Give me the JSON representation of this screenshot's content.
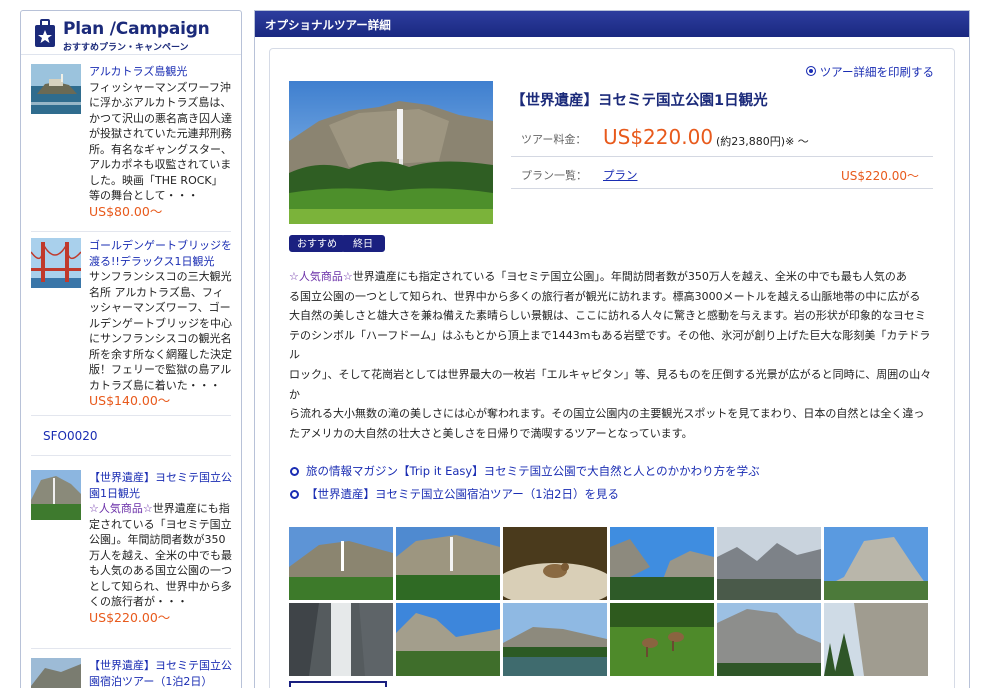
{
  "sidebar": {
    "title": "Plan /Campaign",
    "subtitle": "おすすめプラン・キャンペーン",
    "items": [
      {
        "title": "アルカトラズ島観光",
        "text": "フィッシャーマンズワーフ沖に浮かぶアルカトラズ島は、かつて沢山の悪名高き囚人達が投獄されていた元連邦刑務所。有名なギャングスター、アルカポネも収監されていました。映画「THE ROCK」等の舞台として・・・",
        "price": "US$80.00〜"
      },
      {
        "title": "ゴールデンゲートブリッジを渡る!!デラックス1日観光",
        "text": "サンフランシスコの三大観光名所 アルカトラズ島、フィッシャーマンズワーフ、ゴールデンゲートブリッジを中心にサンフランシスコの観光名所を余す所なく網羅した決定版！フェリーで監獄の島アルカトラズ島に着いた・・・",
        "price": "US$140.00〜"
      },
      {
        "title": "【世界遺産】ヨセミテ国立公園1日観光",
        "text_hl": "☆人気商品☆",
        "text": "世界遺産にも指定されている「ヨセミテ国立公園」。年間訪問者数が350万人を越え、全米の中でも最も人気のある国立公園の一つとして知られ、世界中から多くの旅行者が・・・",
        "price": "US$220.00〜"
      },
      {
        "title": "【世界遺産】ヨセミテ国立公園宿泊ツアー（1泊2日）"
      }
    ],
    "code": "SFO0020"
  },
  "main": {
    "header": "オプショナルツアー詳細",
    "print_link": "ツアー詳細を印刷する",
    "tour_title": "【世界遺産】ヨセミテ国立公園1日観光",
    "price_label": "ツアー料金：",
    "price": "US$220.00",
    "price_note": "(約23,880円)※ 〜",
    "plan_label": "プラン一覧：",
    "plan_link": "プラン",
    "plan_price": "US$220.00〜",
    "badges": [
      "おすすめ",
      "終日"
    ],
    "desc_hl": "☆人気商品☆",
    "desc_lines": [
      "世界遺産にも指定されている「ヨセミテ国立公園」。年間訪問者数が350万人を越え、全米の中でも最も人気のあ",
      "る国立公園の一つとして知られ、世界中から多くの旅行者が観光に訪れます。標高3000メートルを越える山脈地帯の中に広がる",
      "大自然の美しさと雄大さを兼ね備えた素晴らしい景観は、ここに訪れる人々に驚きと感動を与えます。岩の形状が印象的なヨセミ",
      "テのシンボル「ハーフドーム」はふもとから頂上まで1443mもある岩壁です。その他、氷河が創り上げた巨大な彫刻美「カテドラル",
      "ロック」、そして花崗岩としては世界最大の一枚岩「エルキャピタン」等、見るものを圧倒する光景が広がると同時に、周囲の山々か",
      "ら流れる大小無数の滝の美しさには心が奪われます。その国立公園内の主要観光スポットを見てまわり、日本の自然とは全く違っ",
      "たアメリカの大自然の壮大さと美しさを日帰りで満喫するツアーとなっています。"
    ],
    "links": [
      "旅の情報マガジン【Trip it Easy】ヨセミテ国立公園で大自然と人とのかかわり方を学ぶ",
      "【世界遺産】ヨセミテ国立公園宿泊ツアー（1泊2日）を見る"
    ]
  },
  "colors": {
    "accent": "#1a2880",
    "link": "#1a2db3",
    "price": "#e85a1c",
    "highlight": "#6a2fa8"
  }
}
